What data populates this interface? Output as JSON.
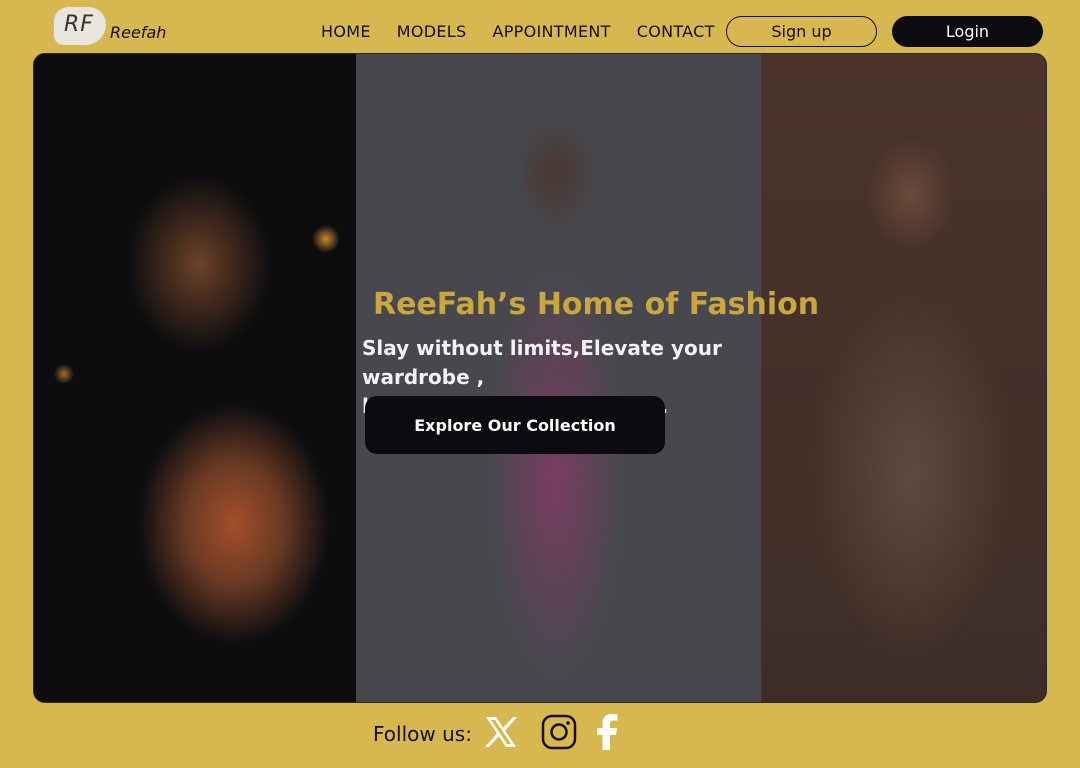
{
  "brand": {
    "mark": "RF",
    "name": "Reefah"
  },
  "nav": {
    "items": [
      "HOME",
      "MODELS",
      "APPOINTMENT",
      "CONTACT"
    ],
    "signup_label": "Sign up",
    "login_label": "Login"
  },
  "hero": {
    "title": "ReeFah’s Home of Fashion",
    "subtitle_line1": "Slay without limits,Elevate your wardrobe ,",
    "subtitle_line2": "lets Fashion speaks of you.",
    "cta_label": "Explore Our Collection",
    "panels": [
      "model-kente-outfit-photo",
      "model-pink-gown-photo",
      "model-satin-dress-photo"
    ]
  },
  "footer": {
    "follow_label": "Follow us:",
    "social_icons": [
      "x-icon",
      "instagram-icon",
      "facebook-icon"
    ]
  },
  "colors": {
    "background": "#d7b74f",
    "accent_title": "#c9a640",
    "dark_button": "#0c0c10"
  }
}
